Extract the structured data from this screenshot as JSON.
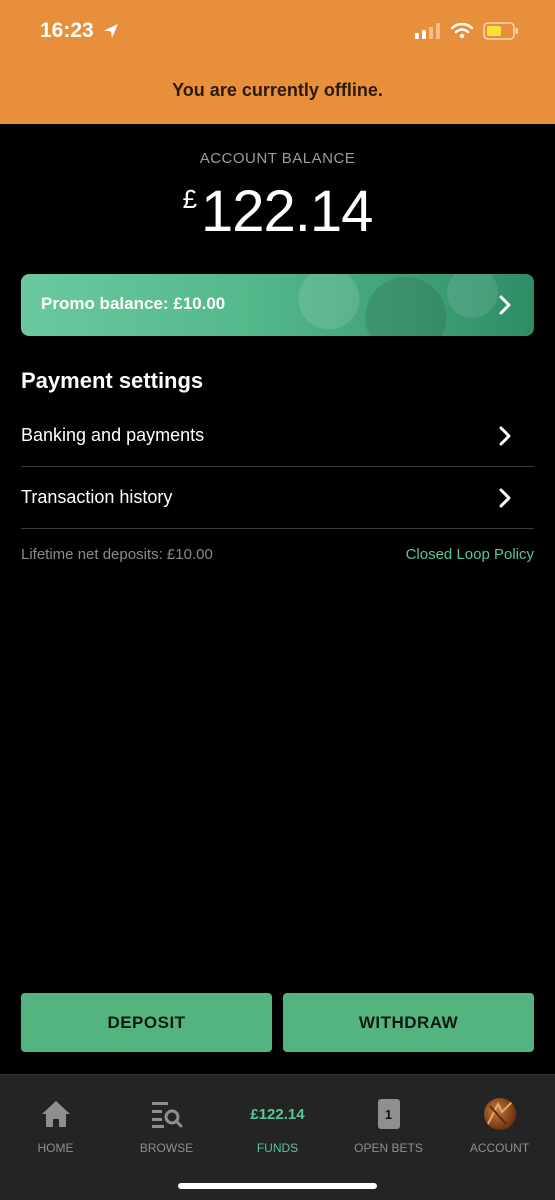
{
  "status_bar": {
    "time": "16:23"
  },
  "banner": {
    "offline_text": "You are currently offline."
  },
  "balance": {
    "label": "ACCOUNT BALANCE",
    "currency": "£",
    "amount": "122.14"
  },
  "promo": {
    "text": "Promo balance: £10.00"
  },
  "payment_settings": {
    "title": "Payment settings",
    "items": [
      {
        "label": "Banking and payments"
      },
      {
        "label": "Transaction history"
      }
    ]
  },
  "footer_info": {
    "lifetime": "Lifetime net deposits: £10.00",
    "policy_link": "Closed Loop Policy"
  },
  "actions": {
    "deposit": "DEPOSIT",
    "withdraw": "WITHDRAW"
  },
  "tabs": [
    {
      "label": "HOME",
      "icon": "home-icon"
    },
    {
      "label": "BROWSE",
      "icon": "browse-icon"
    },
    {
      "label": "FUNDS",
      "amount": "£122.14",
      "active": true
    },
    {
      "label": "OPEN BETS",
      "icon": "bet-slip-icon",
      "badge": "1"
    },
    {
      "label": "ACCOUNT",
      "icon": "avatar"
    }
  ],
  "colors": {
    "banner": "#e88f3c",
    "accent": "#53b47f",
    "link": "#5cc596"
  }
}
